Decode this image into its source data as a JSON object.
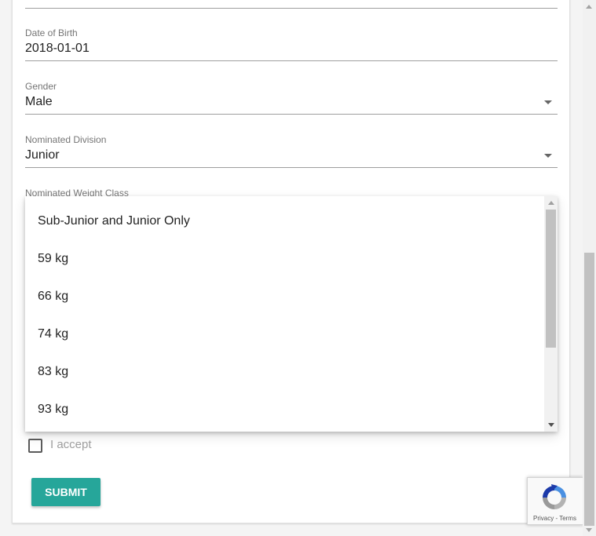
{
  "form": {
    "date_of_birth": {
      "label": "Date of Birth",
      "value": "2018-01-01"
    },
    "gender": {
      "label": "Gender",
      "value": "Male"
    },
    "division": {
      "label": "Nominated Division",
      "value": "Junior"
    },
    "weight_class": {
      "label": "Nominated Weight Class",
      "options": [
        "Sub-Junior and Junior Only",
        "59 kg",
        "66 kg",
        "74 kg",
        "83 kg",
        "93 kg"
      ]
    },
    "accept_label": "I accept",
    "accept_checked": false,
    "submit_label": "SUBMIT"
  },
  "recaptcha": {
    "links": "Privacy - Terms"
  },
  "colors": {
    "accent": "#26a69a",
    "divider": "#9e9e9e",
    "label": "#757575"
  },
  "icons": [
    "chevron-down-icon",
    "checkbox-icon",
    "recaptcha-logo-icon"
  ]
}
